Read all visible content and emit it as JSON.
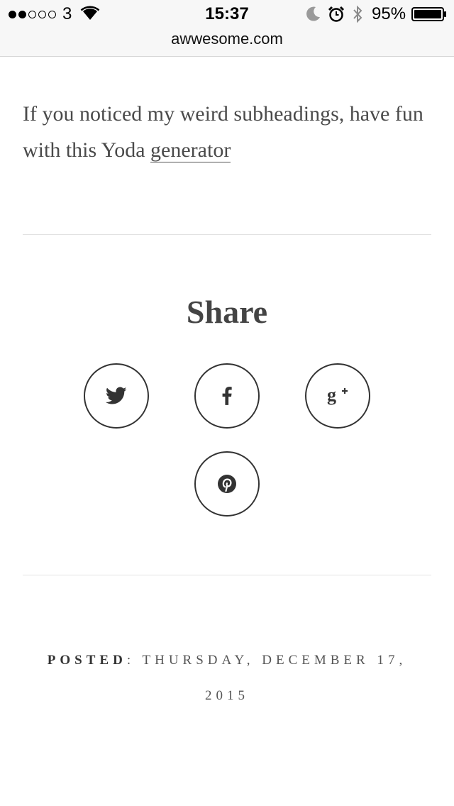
{
  "status_bar": {
    "carrier": "3",
    "time": "15:37",
    "battery_percent": "95%",
    "signal_bars_filled": 2,
    "signal_bars_total": 5
  },
  "browser": {
    "url": "awwesome.com"
  },
  "article": {
    "paragraph_text": "If you noticed my weird subheadings, have fun with this Yoda ",
    "link_text": "generator"
  },
  "share": {
    "title": "Share",
    "buttons": [
      {
        "icon": "twitter-icon"
      },
      {
        "icon": "facebook-icon"
      },
      {
        "icon": "google-plus-icon"
      },
      {
        "icon": "pinterest-icon"
      }
    ]
  },
  "footer": {
    "posted_label": "POSTED",
    "posted_separator": ": ",
    "posted_date": "THURSDAY, DECEMBER 17, 2015"
  },
  "colors": {
    "text": "#4a4a4a",
    "heading": "#444444",
    "divider": "#e2e2e2",
    "status_bar_bg": "#f7f7f7"
  }
}
